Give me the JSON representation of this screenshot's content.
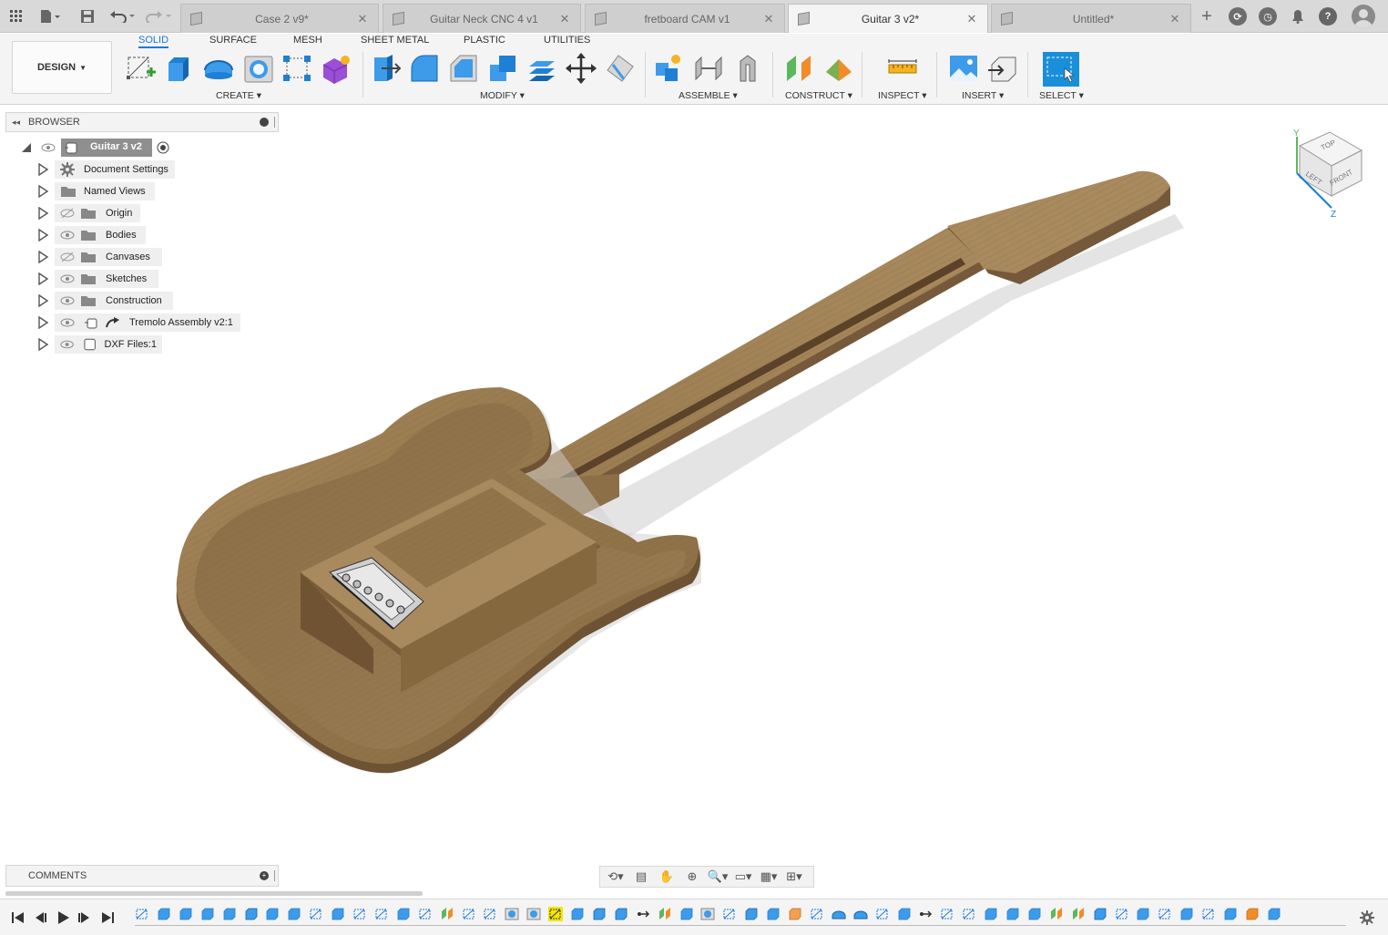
{
  "tabs": [
    {
      "label": "Case 2 v9*"
    },
    {
      "label": "Guitar Neck CNC 4 v1"
    },
    {
      "label": "fretboard CAM v1"
    },
    {
      "label": "Guitar 3 v2*"
    },
    {
      "label": "Untitled*"
    }
  ],
  "toolbar": {
    "workspace": "DESIGN",
    "workspace_tabs": [
      "SOLID",
      "SURFACE",
      "MESH",
      "SHEET METAL",
      "PLASTIC",
      "UTILITIES"
    ],
    "groups": [
      "CREATE",
      "MODIFY",
      "ASSEMBLE",
      "CONSTRUCT",
      "INSPECT",
      "INSERT",
      "SELECT"
    ]
  },
  "browser": {
    "title": "BROWSER",
    "root": "Guitar 3 v2",
    "items": [
      {
        "label": "Document Settings",
        "icon": "gear-icon"
      },
      {
        "label": "Named Views",
        "icon": "folder-icon"
      },
      {
        "label": "Origin",
        "icon": "folder-icon"
      },
      {
        "label": "Bodies",
        "icon": "folder-icon"
      },
      {
        "label": "Canvases",
        "icon": "folder-icon"
      },
      {
        "label": "Sketches",
        "icon": "folder-icon"
      },
      {
        "label": "Construction",
        "icon": "folder-icon"
      },
      {
        "label": "Tremolo Assembly v2:1",
        "icon": "component-link-icon"
      },
      {
        "label": "DXF Files:1",
        "icon": "component-icon"
      }
    ]
  },
  "comments": {
    "title": "COMMENTS"
  },
  "viewcube": {
    "top": "TOP",
    "front": "FRONT",
    "left": "LEFT",
    "axis_y": "Y",
    "axis_z": "Z"
  },
  "colors": {
    "accent": "#1c7bd6",
    "wood": "#9b7a4f",
    "select_blue": "#1a8fd9"
  }
}
